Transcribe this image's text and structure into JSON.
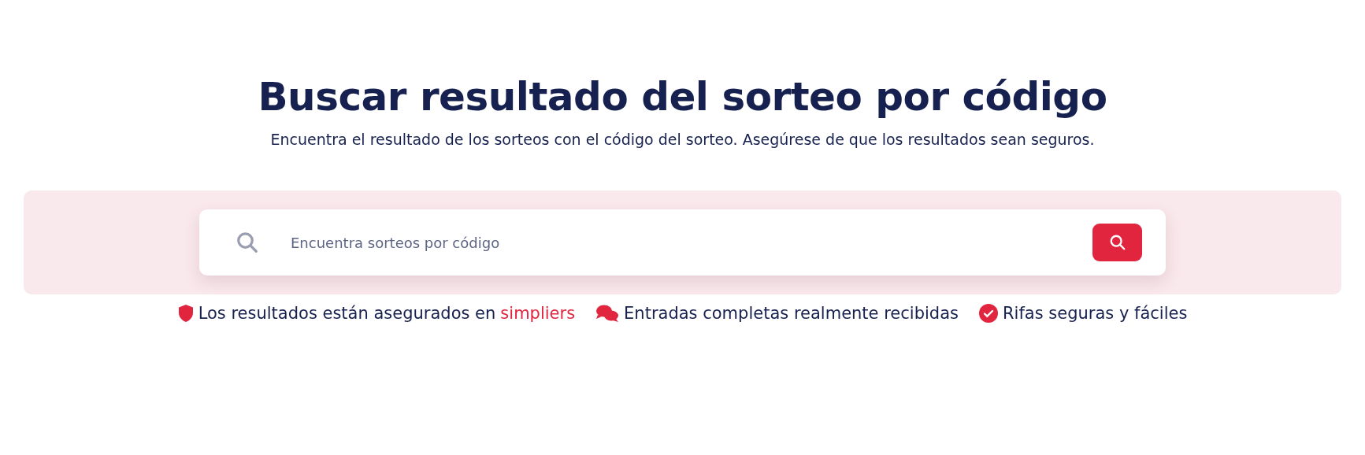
{
  "title": "Buscar resultado del sorteo por código",
  "subtitle": "Encuentra el resultado de los sorteos con el código del sorteo. Asegúrese de que los resultados sean seguros.",
  "search": {
    "placeholder": "Encuentra sorteos por código"
  },
  "features": [
    {
      "kind": "shield",
      "text": "Los resultados están asegurados en",
      "link": "simpliers"
    },
    {
      "kind": "chat",
      "text": "Entradas completas realmente recibidas"
    },
    {
      "kind": "check",
      "text": "Rifas seguras y fáciles"
    }
  ]
}
